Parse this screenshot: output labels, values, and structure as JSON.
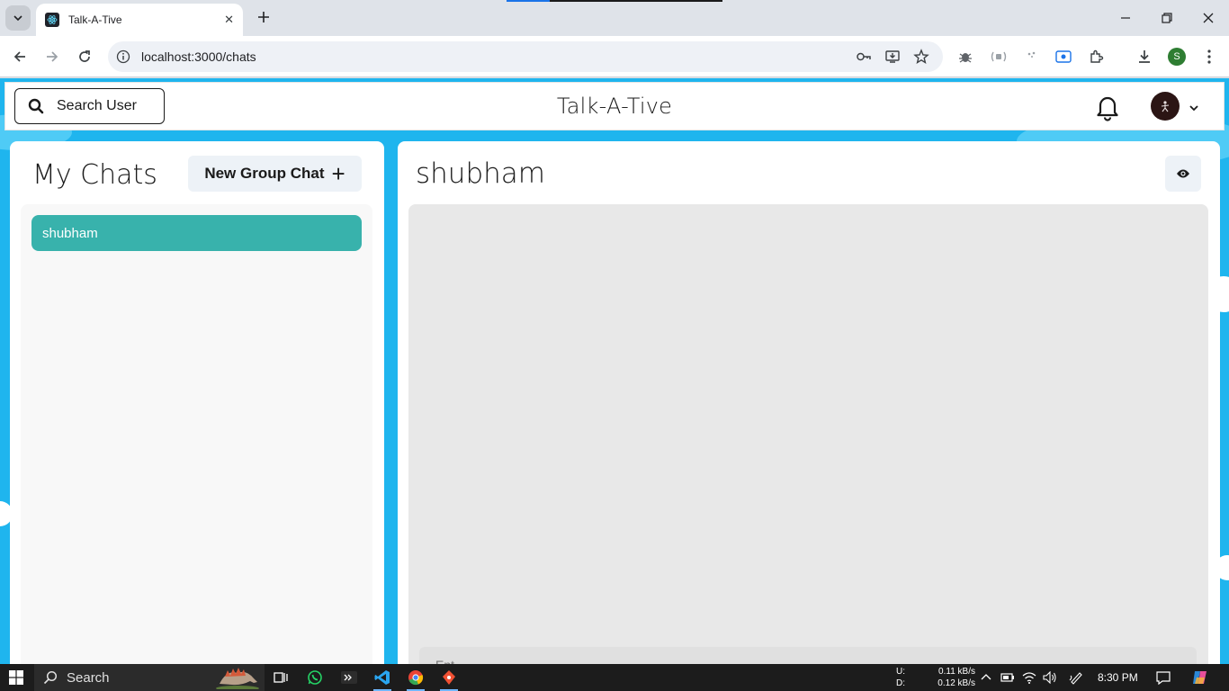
{
  "browser": {
    "tab_title": "Talk-A-Tive",
    "url": "localhost:3000/chats",
    "profile_initial": "S"
  },
  "app": {
    "search_label": "Search User",
    "brand": "Talk-A-Tive"
  },
  "sidebar": {
    "heading": "My Chats",
    "new_group_label": "New Group Chat",
    "chats": [
      {
        "name": "shubham",
        "selected": true
      }
    ]
  },
  "chat": {
    "title": "shubham",
    "input_placeholder": "Ent..."
  },
  "taskbar": {
    "search_label": "Search",
    "net_up_label": "U:",
    "net_up_value": "0.11 kB/s",
    "net_down_label": "D:",
    "net_down_value": "0.12 kB/s",
    "time": "8:30 PM"
  },
  "colors": {
    "app_background": "#1fb5ee",
    "selected_chat": "#38b2ac",
    "button_bg": "#edf2f7"
  }
}
